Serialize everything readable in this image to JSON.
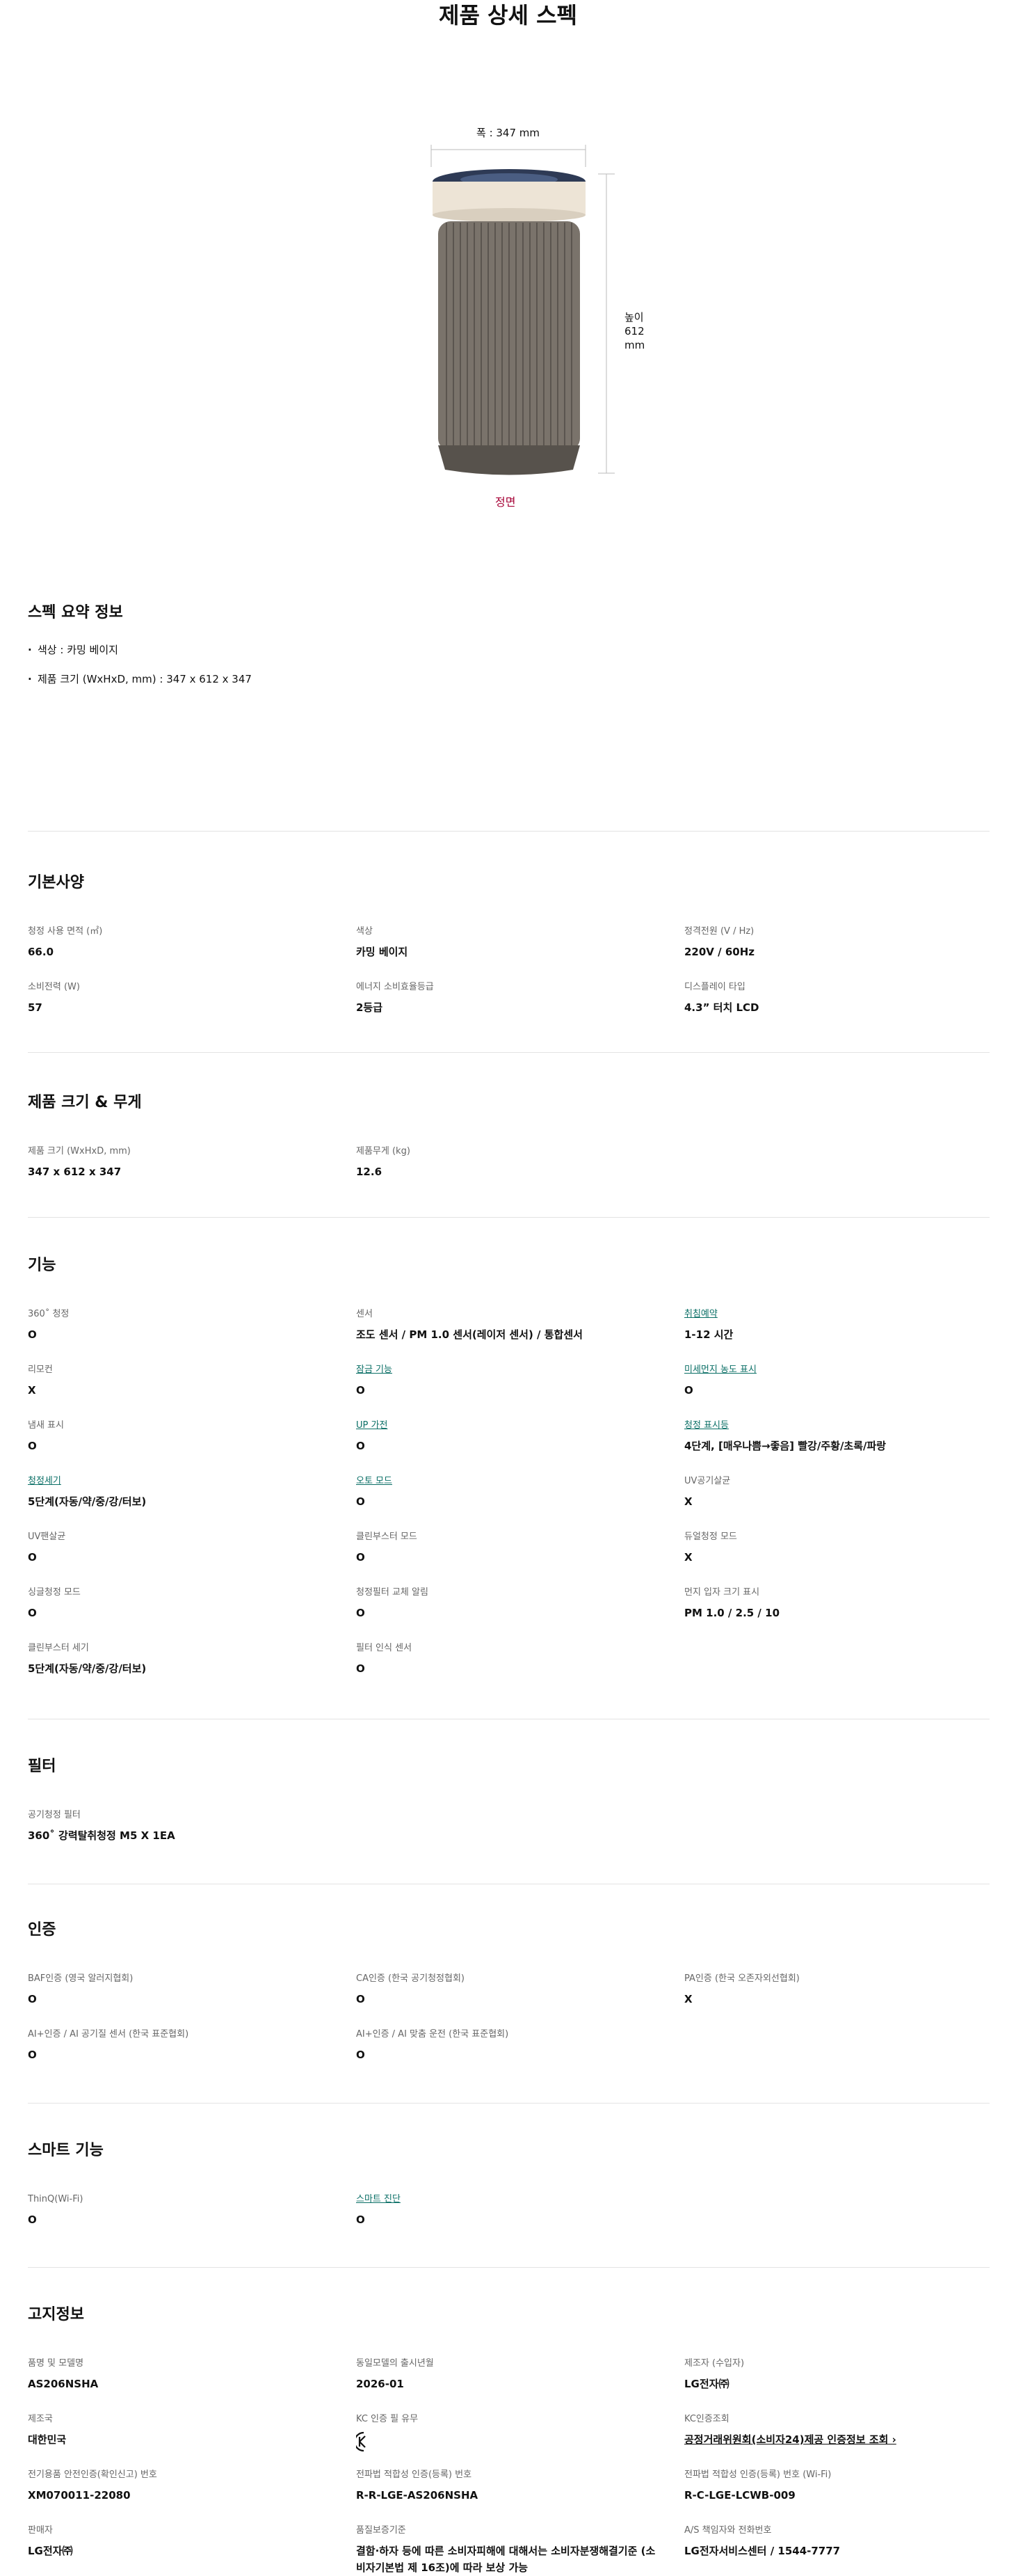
{
  "page": {
    "title": "제품 상세 스펙"
  },
  "dimensions": {
    "width_label": "폭 : 347 mm",
    "height_label_line1": "높이",
    "height_label_line2": "612 mm",
    "view_label": "정면"
  },
  "summary": {
    "title": "스펙 요약 정보",
    "items": [
      "색상 : 카밍 베이지",
      "제품 크기 (WxHxD, mm) : 347 x 612 x 347"
    ]
  },
  "basic": {
    "title": "기본사양",
    "items": [
      {
        "label": "청정 사용 면적 (㎡)",
        "value": "66.0"
      },
      {
        "label": "색상",
        "value": "카밍 베이지"
      },
      {
        "label": "정격전원 (V / Hz)",
        "value": "220V / 60Hz"
      },
      {
        "label": "소비전력 (W)",
        "value": "57"
      },
      {
        "label": "에너지 소비효율등급",
        "value": "2등급"
      },
      {
        "label": "디스플레이 타입",
        "value": "4.3” 터치 LCD"
      }
    ]
  },
  "size": {
    "title": "제품 크기 & 무게",
    "items": [
      {
        "label": "제품 크기 (WxHxD, mm)",
        "value": "347 x 612 x 347"
      },
      {
        "label": "제품무게 (kg)",
        "value": "12.6"
      }
    ]
  },
  "features": {
    "title": "기능",
    "items": [
      {
        "label": "360˚ 청정",
        "value": "O"
      },
      {
        "label": "센서",
        "value": "조도 센서 / PM 1.0 센서(레이저 센서) / 통합센서"
      },
      {
        "label": "취침예약",
        "value": "1-12 시간"
      },
      {
        "label": "리모컨",
        "value": "X"
      },
      {
        "label": "잠금 기능",
        "value": "O"
      },
      {
        "label": "미세먼지 농도 표시",
        "value": "O"
      },
      {
        "label": "냄새 표시",
        "value": "O"
      },
      {
        "label": "UP 가전",
        "value": "O"
      },
      {
        "label": "청정 표시등",
        "value": "4단계, [매우나쁨→좋음] 빨강/주황/초록/파랑"
      },
      {
        "label": "청정세기",
        "value": "5단계(자동/약/중/강/터보)"
      },
      {
        "label": "오토 모드",
        "value": "O"
      },
      {
        "label": "UV공기살균",
        "value": "X"
      },
      {
        "label": "UV팬살균",
        "value": "O"
      },
      {
        "label": "클린부스터 모드",
        "value": "O"
      },
      {
        "label": "듀얼청정 모드",
        "value": "X"
      },
      {
        "label": "싱글청정 모드",
        "value": "O"
      },
      {
        "label": "청정필터 교체 알림",
        "value": "O"
      },
      {
        "label": "먼지 입자 크기 표시",
        "value": "PM 1.0 / 2.5 / 10"
      },
      {
        "label": "클린부스터 세기",
        "value": "5단계(자동/약/중/강/터보)"
      },
      {
        "label": "필터 인식 센서",
        "value": "O"
      }
    ]
  },
  "filter": {
    "title": "필터",
    "items": [
      {
        "label": "공기청정 필터",
        "value": "360˚ 강력탈취청정 M5 X 1EA"
      }
    ]
  },
  "cert": {
    "title": "인증",
    "items": [
      {
        "label": "BAF인증 (영국 알러지협회)",
        "value": "O"
      },
      {
        "label": "CA인증 (한국 공기청정협회)",
        "value": "O"
      },
      {
        "label": "PA인증 (한국 오존자외선협회)",
        "value": "X"
      },
      {
        "label": "AI+인증 / AI 공기질 센서 (한국 표준협회)",
        "value": "O"
      },
      {
        "label": "AI+인증 / AI 맞춤 운전 (한국 표준협회)",
        "value": "O"
      }
    ]
  },
  "smart": {
    "title": "스마트 기능",
    "items": [
      {
        "label": "ThinQ(Wi-Fi)",
        "value": "O"
      },
      {
        "label": "스마트 진단",
        "value": "O"
      }
    ]
  },
  "notice": {
    "title": "고지정보",
    "items": [
      {
        "label": "품명 및 모델명",
        "value": "AS206NSHA"
      },
      {
        "label": "동일모델의 출시년월",
        "value": "2026-01"
      },
      {
        "label": "제조자 (수입자)",
        "value": "LG전자㈜"
      },
      {
        "label": "제조국",
        "value": "대한민국"
      },
      {
        "label": "KC 인증 필 유무",
        "value": ""
      },
      {
        "label": "KC인증조회",
        "value": "공정거래위원회(소비자24)제공 인증정보 조회 ›"
      },
      {
        "label": "전기용품 안전인증(확인신고) 번호",
        "value": "XM070011-22080"
      },
      {
        "label": "전파법 적합성 인증(등록) 번호",
        "value": "R-R-LGE-AS206NSHA"
      },
      {
        "label": "전파법 적합성 인증(등록) 번호 (Wi-Fi)",
        "value": "R-C-LGE-LCWB-009"
      },
      {
        "label": "판매자",
        "value": "LG전자㈜"
      },
      {
        "label": "품질보증기준",
        "value": "결함·하자 등에 따른 소비자피해에 대해서는 소비자분쟁해결기준 (소비자기본법 제 16조)에 따라 보상 가능"
      },
      {
        "label": "A/S 책임자와 전화번호",
        "value": "LG전자서비스센터 / 1544-7777"
      }
    ]
  },
  "colors": {
    "accent": "#a50034",
    "link": "#0a6f66",
    "divider": "#e3e3e3"
  },
  "icons": [
    "kc-certification-mark-icon",
    "chevron-right-icon"
  ]
}
